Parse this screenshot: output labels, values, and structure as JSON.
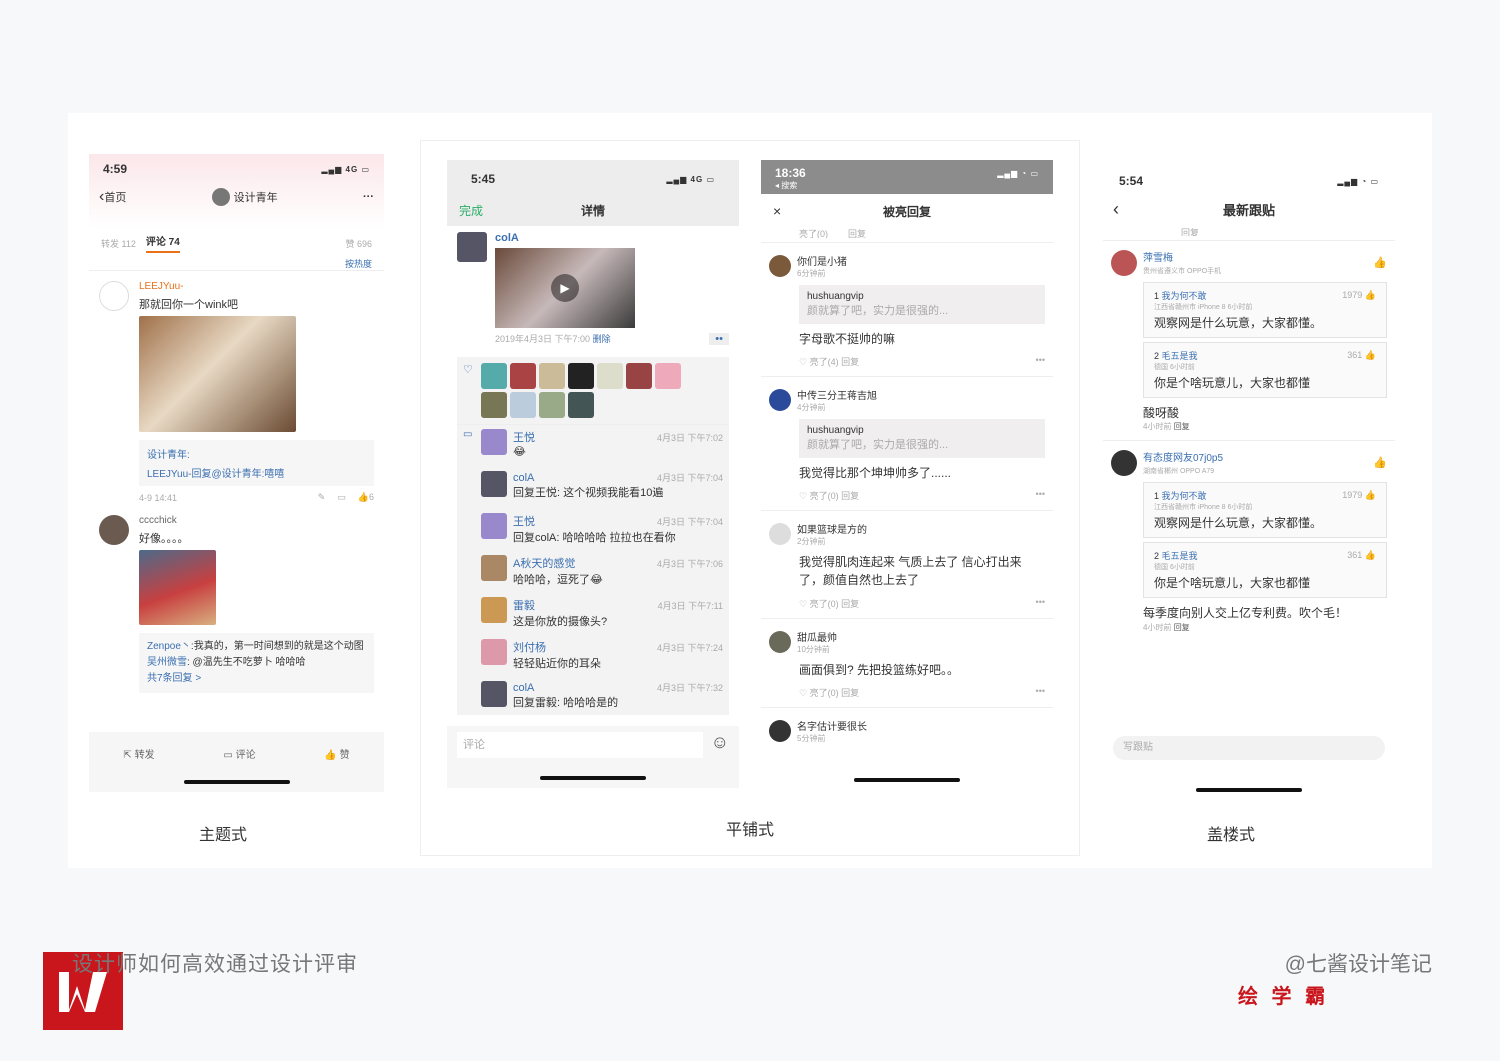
{
  "p1": {
    "time": "4:59",
    "net": "4G",
    "back": "首页",
    "name": "设计青年",
    "more": "···",
    "tabs": {
      "repost": "转发 112",
      "comment": "评论 74",
      "likes": "赞 696",
      "sort": "按热度"
    },
    "c1": {
      "user": "LEEJYuu-",
      "text": "那就回你一个wink吧",
      "r1": "设计青年:",
      "r2": "LEEJYuu-回复@设计青年:嘻嘻",
      "date": "4-9 14:41",
      "likes": "6"
    },
    "c2": {
      "user": "cccchick",
      "text": "好像。。。。",
      "r1a": "Zenpoe丶",
      "r1b": ":我真的，第一时间想到的就是这个动图",
      "r2a": "吴州微雪",
      "r2b": ": @温先生不吃萝卜 哈哈哈",
      "more": "共7条回复 >"
    },
    "bottom": {
      "repost": "转发",
      "comment": "评论",
      "like": "赞"
    },
    "caption": "主题式"
  },
  "p2": {
    "time": "5:45",
    "net": "4G",
    "done": "完成",
    "title": "详情",
    "author": "colA",
    "date": "2019年4月3日 下午7:00",
    "del": "删除",
    "comments": [
      {
        "name": "王悦",
        "text": "😂",
        "time": "4月3日 下午7:02"
      },
      {
        "name": "colA",
        "text": "回复王悦: 这个视频我能看10遍",
        "time": "4月3日 下午7:04"
      },
      {
        "name": "王悦",
        "text": "回复colA: 哈哈哈哈 拉拉也在看你",
        "time": "4月3日 下午7:04"
      },
      {
        "name": "A秋天的感觉",
        "text": "哈哈哈，逗死了😂",
        "time": "4月3日 下午7:06"
      },
      {
        "name": "雷毅",
        "text": "这是你放的摄像头?",
        "time": "4月3日 下午7:11"
      },
      {
        "name": "刘付杨",
        "text": "轻轻贴近你的耳朵",
        "time": "4月3日 下午7:24"
      },
      {
        "name": "colA",
        "text": "回复雷毅: 哈哈哈是的",
        "time": "4月3日 下午7:32"
      }
    ],
    "input": "评论"
  },
  "p3": {
    "time": "18:36",
    "back": "◂ 搜索",
    "title": "被亮回复",
    "close": "×",
    "top": {
      "like": "亮了(0)",
      "reply": "回复"
    },
    "items": [
      {
        "user": "你们是小猪",
        "time": "6分钟前",
        "quote_user": "hushuangvip",
        "quote": "颜就算了吧，实力是很强的...",
        "text": "字母歌不挺帅的嘛",
        "like": "亮了(4)",
        "reply": "回复"
      },
      {
        "user": "中传三分王蒋吉旭",
        "time": "4分钟前",
        "quote_user": "hushuangvip",
        "quote": "颜就算了吧，实力是很强的...",
        "text": "我觉得比那个坤坤帅多了......",
        "like": "亮了(0)",
        "reply": "回复"
      },
      {
        "user": "如果篮球是方的",
        "time": "2分钟前",
        "text": "我觉得肌肉连起来 气质上去了 信心打出来了，颜值自然也上去了",
        "like": "亮了(0)",
        "reply": "回复"
      },
      {
        "user": "甜瓜最帅",
        "time": "10分钟前",
        "text": "画面俱到? 先把投篮练好吧。。",
        "like": "亮了(0)",
        "reply": "回复"
      },
      {
        "user": "名字估计要很长",
        "time": "5分钟前"
      }
    ],
    "caption": "平铺式"
  },
  "p4": {
    "time": "5:54",
    "title": "最新跟贴",
    "prev": "回复",
    "posts": [
      {
        "user": "萍雪梅",
        "loc": "贵州省遵义市  OPPO手机",
        "floors": [
          {
            "n": "1",
            "user": "我为何不敢",
            "meta": "江西省赣州市 iPhone 8  6小时前",
            "likes": "1979",
            "text": "观察网是什么玩意，大家都懂。"
          },
          {
            "n": "2",
            "user": "毛五是我",
            "meta": "德国  6小时前",
            "likes": "361",
            "text": "你是个啥玩意儿，大家也都懂"
          }
        ],
        "text": "酸呀酸",
        "time": "4小时前",
        "reply": "回复"
      },
      {
        "user": "有态度网友07j0p5",
        "loc": "湖南省郴州  OPPO A79",
        "floors": [
          {
            "n": "1",
            "user": "我为何不敢",
            "meta": "江西省赣州市 iPhone 8  6小时前",
            "likes": "1979",
            "text": "观察网是什么玩意，大家都懂。"
          },
          {
            "n": "2",
            "user": "毛五是我",
            "meta": "德国  6小时前",
            "likes": "361",
            "text": "你是个啥玩意儿，大家也都懂"
          }
        ],
        "text": "每季度向别人交上亿专利费。吹个毛！",
        "time": "4小时前",
        "reply": "回复"
      }
    ],
    "input": "写跟贴",
    "caption": "盖楼式"
  },
  "footer": {
    "left_text": "设计师如何高效通过设计评审",
    "right_text": "@七酱设计笔记",
    "brand": "绘 学 霸"
  },
  "colors": {
    "logo_red": "#c9161c",
    "accent_orange": "#e8711a",
    "link_blue": "#3a6fb0",
    "green": "#2aae67"
  }
}
